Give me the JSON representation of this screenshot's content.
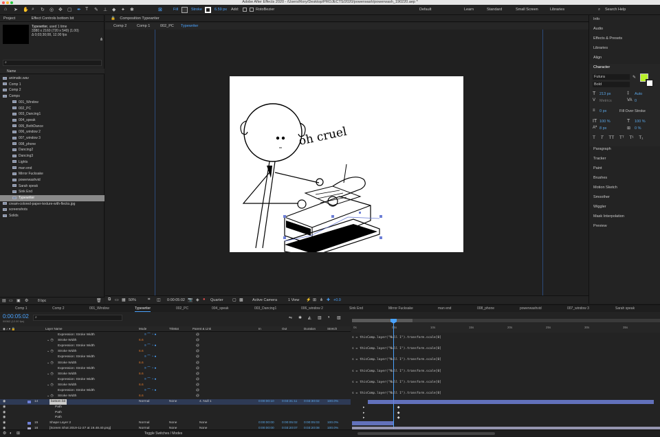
{
  "window": {
    "title": "Adobe After Effects 2020 - /Users/Rory/Desktop/PROJECTS/2020/powerwash/powerwash_190220.aep *"
  },
  "toolbar": {
    "fill_label": "Fill",
    "stroke_label": "Stroke",
    "stroke_width": "6.59 px",
    "add_label": "Add:",
    "rotobezier_label": "RotoBezier",
    "workspaces": [
      "Default",
      "Learn",
      "Standard",
      "Small Screen",
      "Libraries"
    ],
    "search_placeholder": "Search Help"
  },
  "project_panel": {
    "tab_project": "Project",
    "tab_effect_controls": "Effect Controls bottom bit",
    "selected_name": "Typewriter",
    "selected_used": ", used 1 time",
    "selected_dims": "3380 x 2160 (720 x 540) (1.00)",
    "selected_dur": "Δ 0;03;30;08, 12.00 fps",
    "column_name": "Name",
    "items": [
      {
        "label": "animatic.wav",
        "indent": 0
      },
      {
        "label": "Comp 1",
        "indent": 0
      },
      {
        "label": "Comp 2",
        "indent": 0
      },
      {
        "label": "Comps",
        "indent": 0
      },
      {
        "label": "001_Window",
        "indent": 1
      },
      {
        "label": "002_PC",
        "indent": 1
      },
      {
        "label": "003_Dancing1",
        "indent": 1
      },
      {
        "label": "004_speak",
        "indent": 1
      },
      {
        "label": "005_BothDance",
        "indent": 1
      },
      {
        "label": "006_window 2",
        "indent": 1
      },
      {
        "label": "007_window 3",
        "indent": 1
      },
      {
        "label": "008_phone",
        "indent": 1
      },
      {
        "label": "Dancing2",
        "indent": 1
      },
      {
        "label": "Dancing3",
        "indent": 1
      },
      {
        "label": "Lights",
        "indent": 1
      },
      {
        "label": "man end",
        "indent": 1
      },
      {
        "label": "Mirror Fucksake",
        "indent": 1
      },
      {
        "label": "powerwashvid",
        "indent": 1
      },
      {
        "label": "Sarah speak",
        "indent": 1
      },
      {
        "label": "Sink End",
        "indent": 1
      },
      {
        "label": "Typewriter",
        "indent": 1,
        "selected": true
      },
      {
        "label": "cream-colored-paper-texture-with-flecks.jpg",
        "indent": 0
      },
      {
        "label": "screenshots",
        "indent": 0
      },
      {
        "label": "Solids",
        "indent": 0
      }
    ],
    "bpc": "8 bpc"
  },
  "composition": {
    "tab_label": "Composition Typewriter",
    "breadcrumbs": [
      "Comp 2",
      "Comp 1",
      "002_PC",
      "Typewriter"
    ],
    "canvas_text": "oh cruel",
    "zoom": "50%",
    "timecode": "0:00:05:02",
    "resolution": "Quarter",
    "camera": "Active Camera",
    "views": "1 View",
    "exposure": "+0.0"
  },
  "right_panel": {
    "sections_top": [
      "Info",
      "Audio",
      "Effects & Presets",
      "Libraries",
      "Align",
      "Character"
    ],
    "font_name": "Futura",
    "font_style": "Bold",
    "font_size": "213 px",
    "leading": "Auto",
    "kerning": "Metrics",
    "tracking": "0",
    "stroke_size": "0 px",
    "stroke_mode": "Fill Over Stroke",
    "vscale": "100 %",
    "hscale": "100 %",
    "baseline": "8 px",
    "tsume": "0 %",
    "style_buttons": [
      "T",
      "T",
      "TT",
      "Tᵀ",
      "T¹",
      "T₁"
    ],
    "sections_bottom": [
      "Paragraph",
      "Tracker",
      "Paint",
      "Brushes",
      "Motion Sketch",
      "Smoother",
      "Wiggler",
      "Mask Interpolation",
      "Preview"
    ],
    "fill_color": "#b8f02a"
  },
  "timeline": {
    "tabs": [
      "Comp 1",
      "Comp 2",
      "001_Window",
      "Typewriter",
      "002_PC",
      "004_speak",
      "003_Dancing1",
      "006_window 2",
      "Sink End",
      "Mirror Fucksake",
      "man end",
      "008_phone",
      "powerwashvid",
      "007_window 3",
      "Sarah speak"
    ],
    "timecode": "0:00:05:02",
    "timecode_sub": "00062 (12.00 fps)",
    "columns": {
      "layer_name": "Layer Name",
      "mode": "Mode",
      "trkmat": "TrkMat",
      "parent": "Parent & Link",
      "in": "In",
      "out": "Out",
      "duration": "Duration",
      "stretch": "Stretch"
    },
    "ruler": [
      "0s",
      "05s",
      "10s",
      "15s",
      "20s",
      "25s",
      "30s",
      "35s"
    ],
    "expr_rows": [
      {
        "label": "Expression: Stroke Width",
        "value": ""
      },
      {
        "label": "Stroke Width",
        "value": "6.6"
      },
      {
        "label": "Expression: Stroke Width",
        "value": ""
      },
      {
        "label": "Stroke Width",
        "value": "6.6"
      },
      {
        "label": "Expression: Stroke Width",
        "value": ""
      },
      {
        "label": "Stroke Width",
        "value": "6.6"
      },
      {
        "label": "Expression: Stroke Width",
        "value": ""
      },
      {
        "label": "Stroke Width",
        "value": "6.6"
      },
      {
        "label": "Expression: Stroke Width",
        "value": ""
      },
      {
        "label": "Stroke Width",
        "value": "6.6"
      },
      {
        "label": "Expression: Stroke Width",
        "value": ""
      },
      {
        "label": "Stroke Width",
        "value": "6.6"
      }
    ],
    "expression_text": "s = thisComp.layer(\"Null 1\").transform.scale[0]",
    "layers": [
      {
        "num": "14",
        "name": "bottom bit",
        "mode": "Normal",
        "trkmat": "None",
        "parent": "4. Null 1",
        "in": "0:00:00:10",
        "out": "0:03:31:11",
        "dur": "0:03:30:02",
        "stretch": "100.0%",
        "color": "#6d7fd6"
      },
      {
        "num": "",
        "name": "Path",
        "sub": true
      },
      {
        "num": "",
        "name": "Path",
        "sub": true
      },
      {
        "num": "",
        "name": "Path",
        "sub": true
      },
      {
        "num": "15",
        "name": "Shape Layer 2",
        "mode": "Normal",
        "trkmat": "None",
        "parent": "None",
        "in": "0:00:00:00",
        "out": "0:00:05:02",
        "dur": "0:00:05:03",
        "stretch": "100.0%",
        "color": "#6d7fd6"
      },
      {
        "num": "16",
        "name": "[Screen Shot 2019-11-27 at 19.48.40.png]",
        "mode": "Normal",
        "trkmat": "None",
        "parent": "None",
        "in": "0:00:00:00",
        "out": "0:03:20:07",
        "dur": "0:03:20:08",
        "stretch": "100.0%",
        "color": "#a9a9c9"
      },
      {
        "num": "17",
        "name": "[White Solid 3]",
        "mode": "Normal",
        "trkmat": "None",
        "parent": "None",
        "in": "0:00:00:00",
        "out": "0:03:20:07",
        "dur": "0:03:20:08",
        "stretch": "100.0%",
        "color": "#d45a5a"
      }
    ],
    "toggle_label": "Toggle Switches / Modes"
  }
}
